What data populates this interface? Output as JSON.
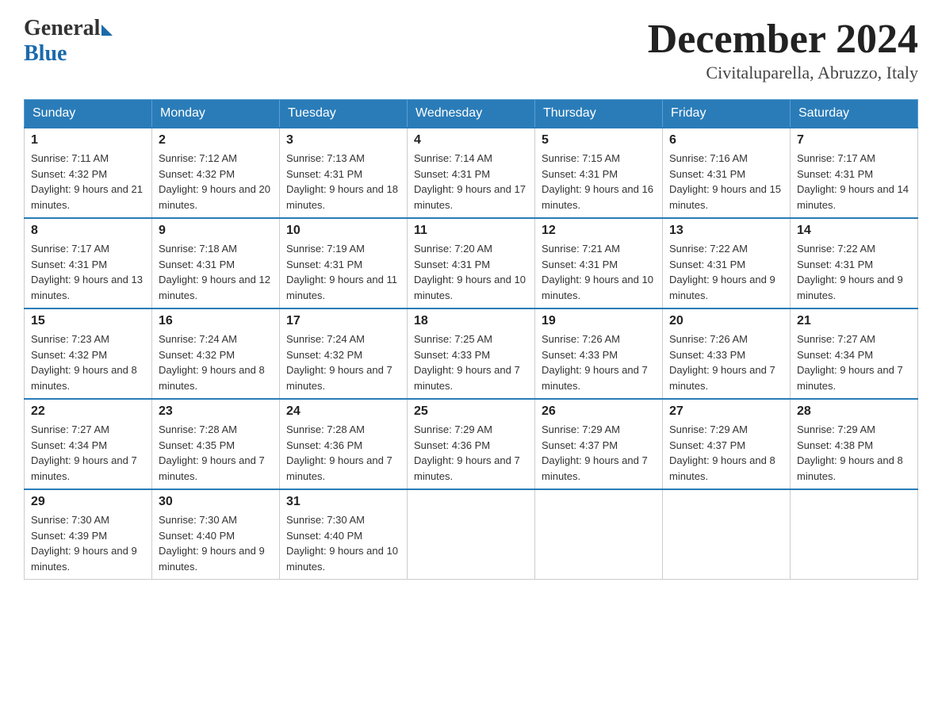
{
  "header": {
    "logo_general": "General",
    "logo_blue": "Blue",
    "month_title": "December 2024",
    "location": "Civitaluparella, Abruzzo, Italy"
  },
  "days_of_week": [
    "Sunday",
    "Monday",
    "Tuesday",
    "Wednesday",
    "Thursday",
    "Friday",
    "Saturday"
  ],
  "weeks": [
    [
      {
        "day": "1",
        "sunrise": "7:11 AM",
        "sunset": "4:32 PM",
        "daylight": "9 hours and 21 minutes."
      },
      {
        "day": "2",
        "sunrise": "7:12 AM",
        "sunset": "4:32 PM",
        "daylight": "9 hours and 20 minutes."
      },
      {
        "day": "3",
        "sunrise": "7:13 AM",
        "sunset": "4:31 PM",
        "daylight": "9 hours and 18 minutes."
      },
      {
        "day": "4",
        "sunrise": "7:14 AM",
        "sunset": "4:31 PM",
        "daylight": "9 hours and 17 minutes."
      },
      {
        "day": "5",
        "sunrise": "7:15 AM",
        "sunset": "4:31 PM",
        "daylight": "9 hours and 16 minutes."
      },
      {
        "day": "6",
        "sunrise": "7:16 AM",
        "sunset": "4:31 PM",
        "daylight": "9 hours and 15 minutes."
      },
      {
        "day": "7",
        "sunrise": "7:17 AM",
        "sunset": "4:31 PM",
        "daylight": "9 hours and 14 minutes."
      }
    ],
    [
      {
        "day": "8",
        "sunrise": "7:17 AM",
        "sunset": "4:31 PM",
        "daylight": "9 hours and 13 minutes."
      },
      {
        "day": "9",
        "sunrise": "7:18 AM",
        "sunset": "4:31 PM",
        "daylight": "9 hours and 12 minutes."
      },
      {
        "day": "10",
        "sunrise": "7:19 AM",
        "sunset": "4:31 PM",
        "daylight": "9 hours and 11 minutes."
      },
      {
        "day": "11",
        "sunrise": "7:20 AM",
        "sunset": "4:31 PM",
        "daylight": "9 hours and 10 minutes."
      },
      {
        "day": "12",
        "sunrise": "7:21 AM",
        "sunset": "4:31 PM",
        "daylight": "9 hours and 10 minutes."
      },
      {
        "day": "13",
        "sunrise": "7:22 AM",
        "sunset": "4:31 PM",
        "daylight": "9 hours and 9 minutes."
      },
      {
        "day": "14",
        "sunrise": "7:22 AM",
        "sunset": "4:31 PM",
        "daylight": "9 hours and 9 minutes."
      }
    ],
    [
      {
        "day": "15",
        "sunrise": "7:23 AM",
        "sunset": "4:32 PM",
        "daylight": "9 hours and 8 minutes."
      },
      {
        "day": "16",
        "sunrise": "7:24 AM",
        "sunset": "4:32 PM",
        "daylight": "9 hours and 8 minutes."
      },
      {
        "day": "17",
        "sunrise": "7:24 AM",
        "sunset": "4:32 PM",
        "daylight": "9 hours and 7 minutes."
      },
      {
        "day": "18",
        "sunrise": "7:25 AM",
        "sunset": "4:33 PM",
        "daylight": "9 hours and 7 minutes."
      },
      {
        "day": "19",
        "sunrise": "7:26 AM",
        "sunset": "4:33 PM",
        "daylight": "9 hours and 7 minutes."
      },
      {
        "day": "20",
        "sunrise": "7:26 AM",
        "sunset": "4:33 PM",
        "daylight": "9 hours and 7 minutes."
      },
      {
        "day": "21",
        "sunrise": "7:27 AM",
        "sunset": "4:34 PM",
        "daylight": "9 hours and 7 minutes."
      }
    ],
    [
      {
        "day": "22",
        "sunrise": "7:27 AM",
        "sunset": "4:34 PM",
        "daylight": "9 hours and 7 minutes."
      },
      {
        "day": "23",
        "sunrise": "7:28 AM",
        "sunset": "4:35 PM",
        "daylight": "9 hours and 7 minutes."
      },
      {
        "day": "24",
        "sunrise": "7:28 AM",
        "sunset": "4:36 PM",
        "daylight": "9 hours and 7 minutes."
      },
      {
        "day": "25",
        "sunrise": "7:29 AM",
        "sunset": "4:36 PM",
        "daylight": "9 hours and 7 minutes."
      },
      {
        "day": "26",
        "sunrise": "7:29 AM",
        "sunset": "4:37 PM",
        "daylight": "9 hours and 7 minutes."
      },
      {
        "day": "27",
        "sunrise": "7:29 AM",
        "sunset": "4:37 PM",
        "daylight": "9 hours and 8 minutes."
      },
      {
        "day": "28",
        "sunrise": "7:29 AM",
        "sunset": "4:38 PM",
        "daylight": "9 hours and 8 minutes."
      }
    ],
    [
      {
        "day": "29",
        "sunrise": "7:30 AM",
        "sunset": "4:39 PM",
        "daylight": "9 hours and 9 minutes."
      },
      {
        "day": "30",
        "sunrise": "7:30 AM",
        "sunset": "4:40 PM",
        "daylight": "9 hours and 9 minutes."
      },
      {
        "day": "31",
        "sunrise": "7:30 AM",
        "sunset": "4:40 PM",
        "daylight": "9 hours and 10 minutes."
      },
      null,
      null,
      null,
      null
    ]
  ],
  "labels": {
    "sunrise": "Sunrise:",
    "sunset": "Sunset:",
    "daylight": "Daylight:"
  }
}
